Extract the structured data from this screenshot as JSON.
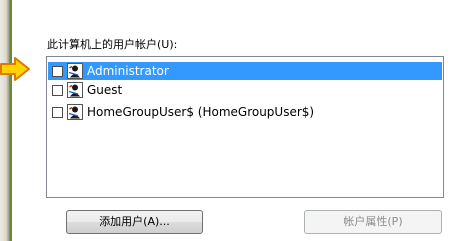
{
  "section": {
    "label": "此计算机上的用户帐户(U):"
  },
  "users": [
    {
      "name": "Administrator",
      "checked": false,
      "selected": true
    },
    {
      "name": "Guest",
      "checked": false,
      "selected": false
    },
    {
      "name": "HomeGroupUser$ (HomeGroupUser$)",
      "checked": false,
      "selected": false
    }
  ],
  "buttons": {
    "add_user": "添加用户(A)...",
    "properties": "帐户属性(P)"
  },
  "colors": {
    "selection": "#3399ff",
    "arrow_fill": "#ffd200",
    "arrow_stroke": "#e07800"
  },
  "icons": {
    "user": "user-account-icon",
    "pointer": "arrow-right-icon"
  }
}
